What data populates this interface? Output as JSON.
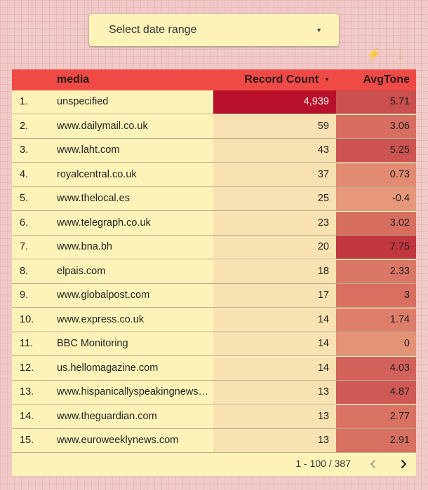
{
  "date_control": {
    "label": "Select date range"
  },
  "table": {
    "headers": {
      "media": "media",
      "count": "Record Count",
      "tone": "AvgTone"
    },
    "rows": [
      {
        "num": "1.",
        "media": "unspecified",
        "count": "4,939",
        "count_value": 4939,
        "tone": "5.71",
        "tone_value": 5.71
      },
      {
        "num": "2.",
        "media": "www.dailymail.co.uk",
        "count": "59",
        "count_value": 59,
        "tone": "3.06",
        "tone_value": 3.06
      },
      {
        "num": "3.",
        "media": "www.laht.com",
        "count": "43",
        "count_value": 43,
        "tone": "5.25",
        "tone_value": 5.25
      },
      {
        "num": "4.",
        "media": "royalcentral.co.uk",
        "count": "37",
        "count_value": 37,
        "tone": "0.73",
        "tone_value": 0.73
      },
      {
        "num": "5.",
        "media": "www.thelocal.es",
        "count": "25",
        "count_value": 25,
        "tone": "-0.4",
        "tone_value": -0.4
      },
      {
        "num": "6.",
        "media": "www.telegraph.co.uk",
        "count": "23",
        "count_value": 23,
        "tone": "3.02",
        "tone_value": 3.02
      },
      {
        "num": "7.",
        "media": "www.bna.bh",
        "count": "20",
        "count_value": 20,
        "tone": "7.75",
        "tone_value": 7.75
      },
      {
        "num": "8.",
        "media": "elpais.com",
        "count": "18",
        "count_value": 18,
        "tone": "2.33",
        "tone_value": 2.33
      },
      {
        "num": "9.",
        "media": "www.globalpost.com",
        "count": "17",
        "count_value": 17,
        "tone": "3",
        "tone_value": 3
      },
      {
        "num": "10.",
        "media": "www.express.co.uk",
        "count": "14",
        "count_value": 14,
        "tone": "1.74",
        "tone_value": 1.74
      },
      {
        "num": "11.",
        "media": "BBC Monitoring",
        "count": "14",
        "count_value": 14,
        "tone": "0",
        "tone_value": 0
      },
      {
        "num": "12.",
        "media": "us.hellomagazine.com",
        "count": "14",
        "count_value": 14,
        "tone": "4.03",
        "tone_value": 4.03
      },
      {
        "num": "13.",
        "media": "www.hispanicallyspeakingnews…",
        "count": "13",
        "count_value": 13,
        "tone": "4.87",
        "tone_value": 4.87
      },
      {
        "num": "14.",
        "media": "www.theguardian.com",
        "count": "13",
        "count_value": 13,
        "tone": "2.77",
        "tone_value": 2.77
      },
      {
        "num": "15.",
        "media": "www.euroweeklynews.com",
        "count": "13",
        "count_value": 13,
        "tone": "2.91",
        "tone_value": 2.91
      }
    ]
  },
  "pagination": {
    "range": "1 - 100 / 387"
  },
  "colors": {
    "header": "#ef4a46",
    "panel": "#fdf3b9",
    "count_max": "#b8102a",
    "count_min": "#f8e2b2",
    "tone_max": "#c2363f",
    "tone_min": "#e7987a"
  },
  "icons": {
    "sort": "sort-descending-icon",
    "bolt": "lightning-bolt-icon",
    "menu": "more-vert-icon",
    "prev": "chevron-left-icon",
    "next": "chevron-right-icon"
  }
}
